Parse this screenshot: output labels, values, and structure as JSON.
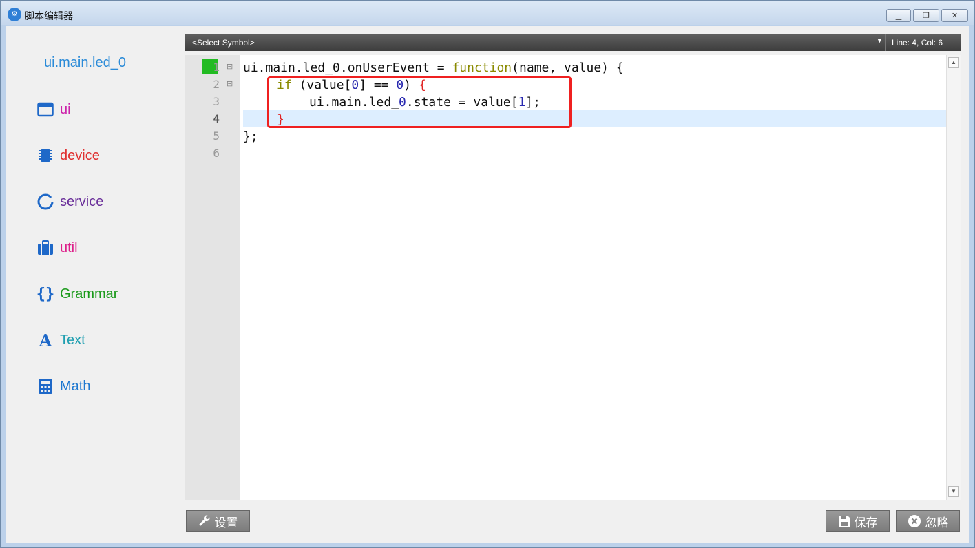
{
  "window": {
    "title": "脚本编辑器",
    "controls": {
      "minimize": "▁",
      "maximize": "❐",
      "close": "✕"
    }
  },
  "sidebar": {
    "title": "ui.main.led_0",
    "items": [
      {
        "label": "ui",
        "icon": "window-icon",
        "color": "#cc22aa"
      },
      {
        "label": "device",
        "icon": "chip-icon",
        "color": "#e02f2f"
      },
      {
        "label": "service",
        "icon": "ring-icon",
        "color": "#6a2f9a"
      },
      {
        "label": "util",
        "icon": "toolbox-icon",
        "color": "#dd1f8a"
      },
      {
        "label": "Grammar",
        "icon": "braces-icon",
        "color": "#1a9a1a"
      },
      {
        "label": "Text",
        "icon": "letter-a-icon",
        "color": "#1f9fb0"
      },
      {
        "label": "Math",
        "icon": "calculator-icon",
        "color": "#1e78d0"
      }
    ]
  },
  "editor": {
    "symbol_select": "<Select Symbol>",
    "position": "Line: 4, Col: 6",
    "line_numbers": [
      "1",
      "2",
      "3",
      "4",
      "5",
      "6"
    ],
    "current_line": 4,
    "code": {
      "l1_a": "ui.main.led_0.onUserEvent = ",
      "l1_kw": "function",
      "l1_b": "(name, value) {",
      "l2_kw": "if",
      "l2_a": " (value[",
      "l2_n1": "0",
      "l2_b": "] == ",
      "l2_n2": "0",
      "l2_c": ") ",
      "l2_br": "{",
      "l3_a": "ui.main.led_",
      "l3_n1": "0",
      "l3_b": ".state = value[",
      "l3_n2": "1",
      "l3_c": "];",
      "l4_br": "}",
      "l5": "};",
      "l6": ""
    }
  },
  "buttons": {
    "settings": "设置",
    "save": "保存",
    "ignore": "忽略"
  },
  "colors": {
    "accent": "#2b8bd8",
    "keyword": "#8a8a00",
    "number": "#2a2ab0",
    "brace": "#e02020",
    "highlight_box": "#ef2020"
  }
}
